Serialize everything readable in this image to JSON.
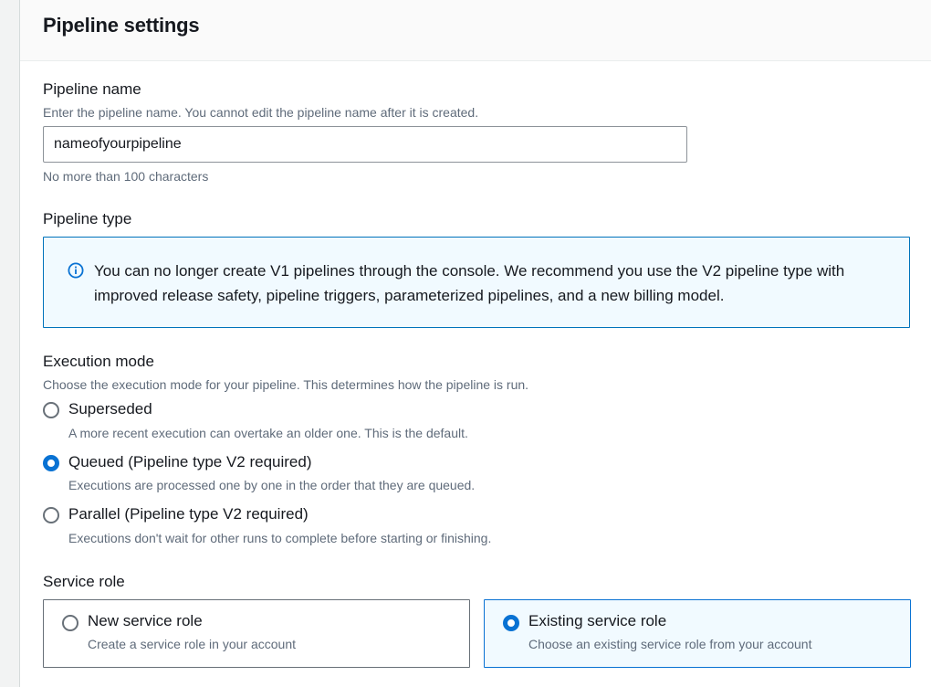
{
  "panel": {
    "title": "Pipeline settings"
  },
  "pipeline_name": {
    "label": "Pipeline name",
    "description": "Enter the pipeline name. You cannot edit the pipeline name after it is created.",
    "value": "nameofyourpipeline",
    "constraint": "No more than 100 characters"
  },
  "pipeline_type": {
    "label": "Pipeline type",
    "info_icon": "info-circle-icon",
    "info_text": "You can no longer create V1 pipelines through the console. We recommend you use the V2 pipeline type with improved release safety, pipeline triggers, parameterized pipelines, and a new billing model."
  },
  "execution_mode": {
    "label": "Execution mode",
    "description": "Choose the execution mode for your pipeline. This determines how the pipeline is run.",
    "options": [
      {
        "label": "Superseded",
        "description": "A more recent execution can overtake an older one. This is the default.",
        "selected": false
      },
      {
        "label": "Queued (Pipeline type V2 required)",
        "description": "Executions are processed one by one in the order that they are queued.",
        "selected": true
      },
      {
        "label": "Parallel (Pipeline type V2 required)",
        "description": "Executions don't wait for other runs to complete before starting or finishing.",
        "selected": false
      }
    ]
  },
  "service_role": {
    "label": "Service role",
    "options": [
      {
        "label": "New service role",
        "description": "Create a service role in your account",
        "selected": false
      },
      {
        "label": "Existing service role",
        "description": "Choose an existing service role from your account",
        "selected": true
      }
    ]
  },
  "colors": {
    "accent": "#0972d3",
    "info_background": "#f1faff",
    "info_border": "#0073bb",
    "text_primary": "#16191f",
    "text_secondary": "#5f6b7a"
  }
}
